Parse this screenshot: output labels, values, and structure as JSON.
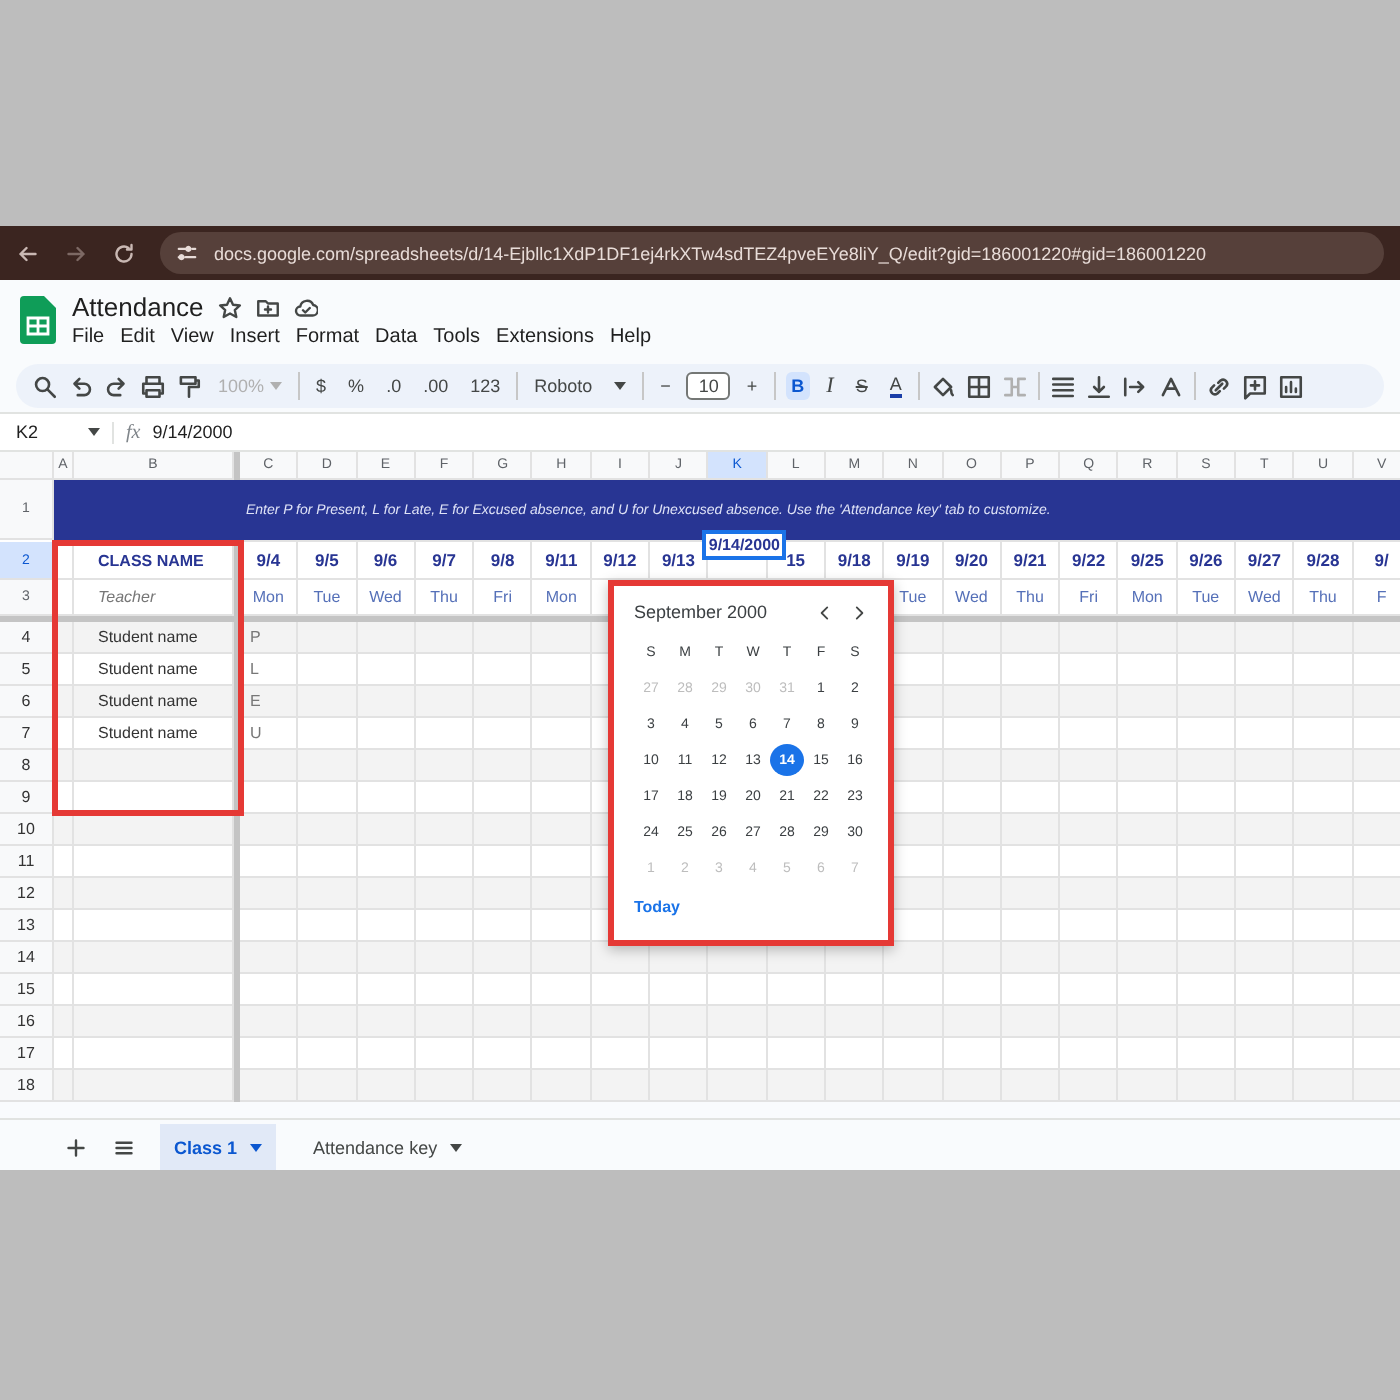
{
  "browser": {
    "url": "docs.google.com/spreadsheets/d/14-Ejbllc1XdP1DF1ej4rkXTw4sdTEZ4pveEYe8liY_Q/edit?gid=186001220#gid=186001220"
  },
  "document": {
    "title": "Attendance",
    "menus": [
      "File",
      "Edit",
      "View",
      "Insert",
      "Format",
      "Data",
      "Tools",
      "Extensions",
      "Help"
    ]
  },
  "toolbar": [
    {
      "kind": "search"
    },
    {
      "kind": "undo"
    },
    {
      "kind": "redo"
    },
    {
      "kind": "print"
    },
    {
      "kind": "paint-format"
    },
    {
      "kind": "dropdown",
      "label": "100%",
      "disabled": true
    },
    {
      "kind": "divider"
    },
    {
      "kind": "text",
      "label": "$"
    },
    {
      "kind": "text",
      "label": "%"
    },
    {
      "kind": "text",
      "label": ".0"
    },
    {
      "kind": "text",
      "label": ".00"
    },
    {
      "kind": "text",
      "label": "123"
    },
    {
      "kind": "divider"
    },
    {
      "kind": "dropdown",
      "label": "Roboto",
      "disabled": false
    },
    {
      "kind": "divider"
    },
    {
      "kind": "text",
      "label": "−"
    },
    {
      "kind": "field",
      "label": "10"
    },
    {
      "kind": "text",
      "label": "+"
    },
    {
      "kind": "divider"
    },
    {
      "kind": "bold",
      "label": "B",
      "selected": true
    },
    {
      "kind": "italic",
      "label": "I",
      "selected": false
    },
    {
      "kind": "strike",
      "label": "S",
      "selected": false
    },
    {
      "kind": "text-color",
      "label": "A",
      "selected": false
    },
    {
      "kind": "divider"
    },
    {
      "kind": "fill"
    },
    {
      "kind": "borders"
    },
    {
      "kind": "merge"
    },
    {
      "kind": "divider"
    },
    {
      "kind": "align"
    },
    {
      "kind": "valign"
    },
    {
      "kind": "wrap"
    },
    {
      "kind": "rotate"
    },
    {
      "kind": "divider"
    },
    {
      "kind": "link"
    },
    {
      "kind": "comment"
    },
    {
      "kind": "chart"
    }
  ],
  "formula_bar": {
    "cell": "K2",
    "fx": "fx",
    "value": "9/14/2000"
  },
  "sheet": {
    "columns": [
      {
        "letter": "A",
        "selected": false
      },
      {
        "letter": "B",
        "selected": false
      },
      {
        "letter": "C",
        "selected": false
      },
      {
        "letter": "D",
        "selected": false
      },
      {
        "letter": "E",
        "selected": false
      },
      {
        "letter": "F",
        "selected": false
      },
      {
        "letter": "G",
        "selected": false
      },
      {
        "letter": "H",
        "selected": false
      },
      {
        "letter": "I",
        "selected": false
      },
      {
        "letter": "J",
        "selected": false
      },
      {
        "letter": "K",
        "selected": true
      },
      {
        "letter": "L",
        "selected": false
      },
      {
        "letter": "M",
        "selected": false
      },
      {
        "letter": "N",
        "selected": false
      },
      {
        "letter": "O",
        "selected": false
      },
      {
        "letter": "P",
        "selected": false
      },
      {
        "letter": "Q",
        "selected": false
      },
      {
        "letter": "R",
        "selected": false
      },
      {
        "letter": "S",
        "selected": false
      },
      {
        "letter": "T",
        "selected": false
      },
      {
        "letter": "U",
        "selected": false
      },
      {
        "letter": "V",
        "selected": false
      }
    ],
    "banner": {
      "number": "1",
      "selected": false,
      "text": "Enter P for Present, L for Late, E for Excused absence, and U for Unexcused absence. Use the 'Attendance key' tab to customize."
    },
    "header_rows": [
      {
        "number": "2",
        "selected": true
      },
      {
        "number": "3",
        "selected": false
      }
    ],
    "class_name": "CLASS NAME",
    "teacher": "Teacher",
    "dates": [
      {
        "date": "9/4",
        "weekday": "Mon"
      },
      {
        "date": "9/5",
        "weekday": "Tue"
      },
      {
        "date": "9/6",
        "weekday": "Wed"
      },
      {
        "date": "9/7",
        "weekday": "Thu"
      },
      {
        "date": "9/8",
        "weekday": "Fri"
      },
      {
        "date": "9/11",
        "weekday": "Mon"
      },
      {
        "date": "9/12"
      },
      {
        "date": "9/13"
      },
      {
        "date": "9/14/2000",
        "editing": true
      },
      {
        "date": "15"
      },
      {
        "date": "9/18"
      },
      {
        "date": "9/19",
        "weekday": "Tue"
      },
      {
        "date": "9/20",
        "weekday": "Wed"
      },
      {
        "date": "9/21",
        "weekday": "Thu"
      },
      {
        "date": "9/22",
        "weekday": "Fri"
      },
      {
        "date": "9/25",
        "weekday": "Mon"
      },
      {
        "date": "9/26",
        "weekday": "Tue"
      },
      {
        "date": "9/27",
        "weekday": "Wed"
      },
      {
        "date": "9/28",
        "weekday": "Thu"
      },
      {
        "date": "9/",
        "weekday": "F"
      }
    ],
    "rows": [
      {
        "number": "4",
        "student": "Student name",
        "mark": "P"
      },
      {
        "number": "5",
        "student": "Student name",
        "mark": "L"
      },
      {
        "number": "6",
        "student": "Student name",
        "mark": "E"
      },
      {
        "number": "7",
        "student": "Student name",
        "mark": "U"
      },
      {
        "number": "8"
      },
      {
        "number": "9"
      },
      {
        "number": "10"
      },
      {
        "number": "11"
      },
      {
        "number": "12"
      },
      {
        "number": "13"
      },
      {
        "number": "14"
      },
      {
        "number": "15"
      },
      {
        "number": "16"
      },
      {
        "number": "17"
      },
      {
        "number": "18"
      }
    ]
  },
  "date_picker": {
    "month": "September 2000",
    "weekdays": [
      "S",
      "M",
      "T",
      "W",
      "T",
      "F",
      "S"
    ],
    "weeks": [
      [
        {
          "day": "27",
          "muted": true,
          "selected": false
        },
        {
          "day": "28",
          "muted": true,
          "selected": false
        },
        {
          "day": "29",
          "muted": true,
          "selected": false
        },
        {
          "day": "30",
          "muted": true,
          "selected": false
        },
        {
          "day": "31",
          "muted": true,
          "selected": false
        },
        {
          "day": "1",
          "muted": false,
          "selected": false
        },
        {
          "day": "2",
          "muted": false,
          "selected": false
        }
      ],
      [
        {
          "day": "3",
          "muted": false,
          "selected": false
        },
        {
          "day": "4",
          "muted": false,
          "selected": false
        },
        {
          "day": "5",
          "muted": false,
          "selected": false
        },
        {
          "day": "6",
          "muted": false,
          "selected": false
        },
        {
          "day": "7",
          "muted": false,
          "selected": false
        },
        {
          "day": "8",
          "muted": false,
          "selected": false
        },
        {
          "day": "9",
          "muted": false,
          "selected": false
        }
      ],
      [
        {
          "day": "10",
          "muted": false,
          "selected": false
        },
        {
          "day": "11",
          "muted": false,
          "selected": false
        },
        {
          "day": "12",
          "muted": false,
          "selected": false
        },
        {
          "day": "13",
          "muted": false,
          "selected": false
        },
        {
          "day": "14",
          "muted": false,
          "selected": true
        },
        {
          "day": "15",
          "muted": false,
          "selected": false
        },
        {
          "day": "16",
          "muted": false,
          "selected": false
        }
      ],
      [
        {
          "day": "17",
          "muted": false,
          "selected": false
        },
        {
          "day": "18",
          "muted": false,
          "selected": false
        },
        {
          "day": "19",
          "muted": false,
          "selected": false
        },
        {
          "day": "20",
          "muted": false,
          "selected": false
        },
        {
          "day": "21",
          "muted": false,
          "selected": false
        },
        {
          "day": "22",
          "muted": false,
          "selected": false
        },
        {
          "day": "23",
          "muted": false,
          "selected": false
        }
      ],
      [
        {
          "day": "24",
          "muted": false,
          "selected": false
        },
        {
          "day": "25",
          "muted": false,
          "selected": false
        },
        {
          "day": "26",
          "muted": false,
          "selected": false
        },
        {
          "day": "27",
          "muted": false,
          "selected": false
        },
        {
          "day": "28",
          "muted": false,
          "selected": false
        },
        {
          "day": "29",
          "muted": false,
          "selected": false
        },
        {
          "day": "30",
          "muted": false,
          "selected": false
        }
      ],
      [
        {
          "day": "1",
          "muted": true,
          "selected": false
        },
        {
          "day": "2",
          "muted": true,
          "selected": false
        },
        {
          "day": "3",
          "muted": true,
          "selected": false
        },
        {
          "day": "4",
          "muted": true,
          "selected": false
        },
        {
          "day": "5",
          "muted": true,
          "selected": false
        },
        {
          "day": "6",
          "muted": true,
          "selected": false
        },
        {
          "day": "7",
          "muted": true,
          "selected": false
        }
      ]
    ],
    "today": "Today"
  },
  "highlights": {
    "class_column": true,
    "date_picker": true
  },
  "sheet_tabs": [
    {
      "label": "Class 1",
      "selected": true
    },
    {
      "label": "Attendance key",
      "selected": false
    }
  ]
}
